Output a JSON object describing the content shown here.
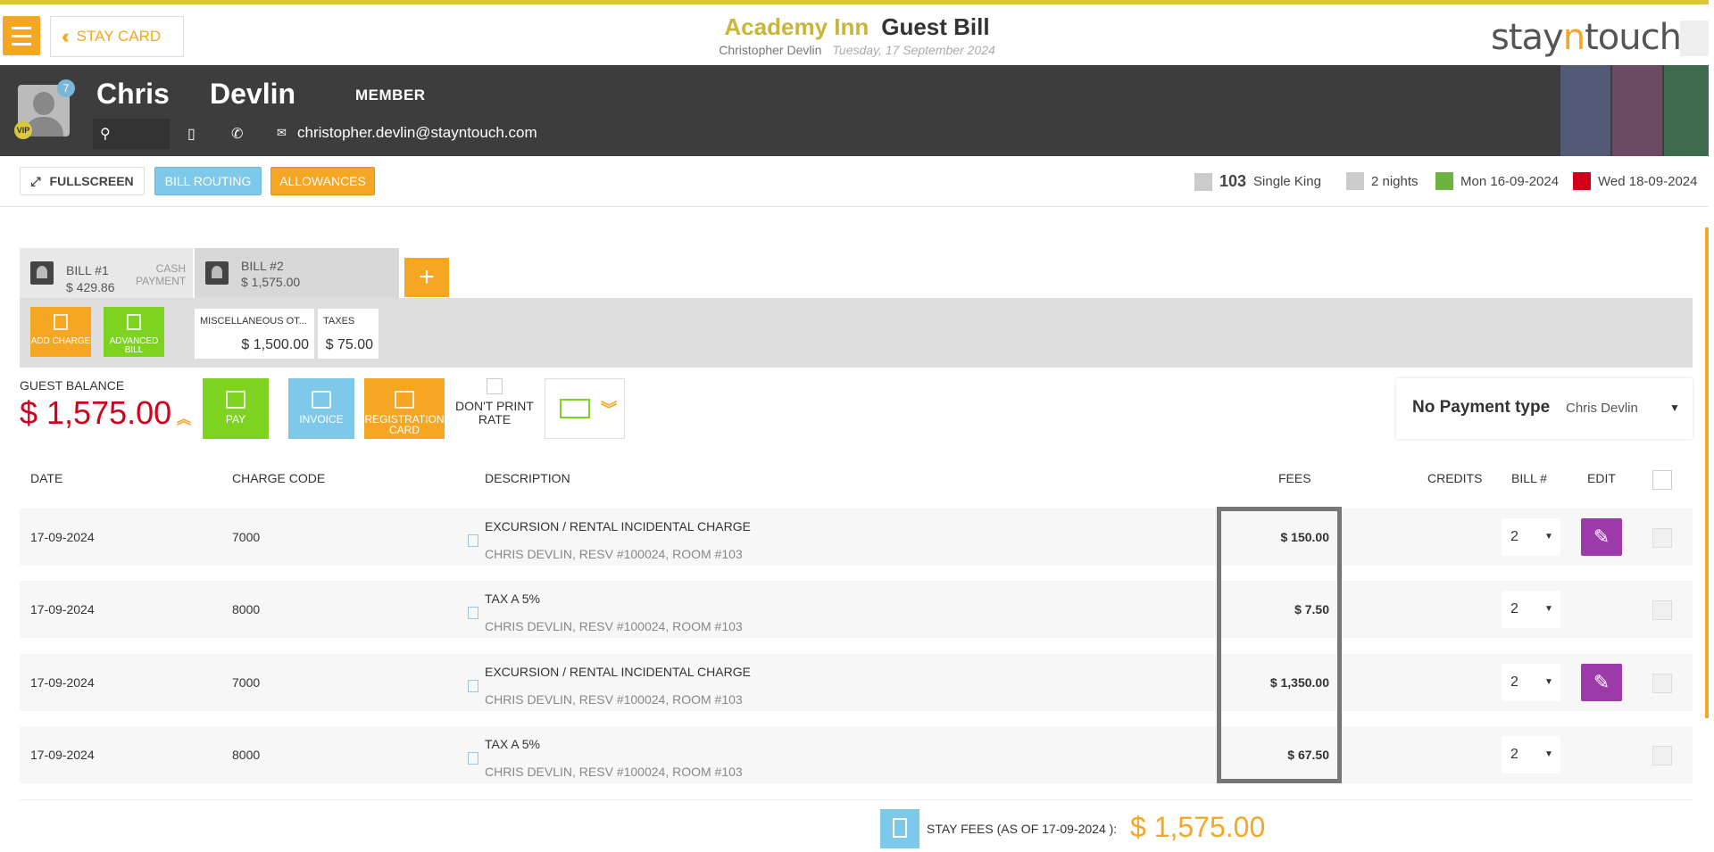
{
  "header": {
    "back_label": "STAY CARD",
    "hotel_name": "Academy Inn",
    "page_title": "Guest Bill",
    "guest_full_name": "Christopher Devlin",
    "date_text": "Tuesday, 17 September 2024",
    "logo_pre": "stay",
    "logo_n": "n",
    "logo_post": "touch"
  },
  "guest": {
    "first_name": "Chris",
    "last_name": "Devlin",
    "member_label": "MEMBER",
    "avatar_count": "7",
    "vip_label": "VIP",
    "email": "christopher.devlin@stayntouch.com"
  },
  "toolbar": {
    "fullscreen_label": "FULLSCREEN",
    "bill_routing_label": "BILL ROUTING",
    "allowances_label": "ALLOWANCES",
    "room_number": "103",
    "room_type": "Single King",
    "nights": "2 nights",
    "arrival": "Mon 16-09-2024",
    "departure": "Wed 18-09-2024"
  },
  "bills": {
    "tab1": {
      "label": "BILL #1",
      "amount": "$ 429.86",
      "caption": "CASH PAYMENT"
    },
    "tab2": {
      "label": "BILL #2",
      "amount": "$ 1,575.00"
    },
    "add_tab": "+",
    "add_charge_label": "ADD CHARGE",
    "advanced_bill_label": "ADVANCED BILL",
    "summary": [
      {
        "label": "MISCELLANEOUS OT...",
        "value": "$ 1,500.00"
      },
      {
        "label": "TAXES",
        "value": "$ 75.00"
      }
    ]
  },
  "balance": {
    "label": "GUEST BALANCE",
    "amount": "$ 1,575.00",
    "pay_label": "PAY",
    "invoice_label": "INVOICE",
    "registration_label": "REGISTRATION CARD",
    "dont_print_label": "DON'T PRINT RATE",
    "payment_type": "No Payment type",
    "payer_name": "Chris Devlin"
  },
  "table": {
    "headers": {
      "date": "DATE",
      "charge_code": "CHARGE CODE",
      "description": "DESCRIPTION",
      "fees": "FEES",
      "credits": "CREDITS",
      "bill_no": "BILL #",
      "edit": "EDIT"
    },
    "rows": [
      {
        "date": "17-09-2024",
        "code": "7000",
        "desc": "EXCURSION / RENTAL INCIDENTAL CHARGE",
        "sub": "CHRIS DEVLIN, RESV #100024, ROOM #103",
        "fee": "$ 150.00",
        "bill": "2",
        "editable": true
      },
      {
        "date": "17-09-2024",
        "code": "8000",
        "desc": "TAX A 5%",
        "sub": "CHRIS DEVLIN, RESV #100024, ROOM #103",
        "fee": "$ 7.50",
        "bill": "2",
        "editable": false
      },
      {
        "date": "17-09-2024",
        "code": "7000",
        "desc": "EXCURSION / RENTAL INCIDENTAL CHARGE",
        "sub": "CHRIS DEVLIN, RESV #100024, ROOM #103",
        "fee": "$ 1,350.00",
        "bill": "2",
        "editable": true
      },
      {
        "date": "17-09-2024",
        "code": "8000",
        "desc": "TAX A 5%",
        "sub": "CHRIS DEVLIN, RESV #100024, ROOM #103",
        "fee": "$ 67.50",
        "bill": "2",
        "editable": false
      }
    ]
  },
  "footer": {
    "stay_fees_label": "STAY FEES (AS OF  17-09-2024 ):",
    "stay_fees_amount": "$ 1,575.00"
  },
  "colors": {
    "accent_orange": "#f5a623",
    "brand_gold": "#c8b53a",
    "balance_red": "#d0021b",
    "edit_purple": "#9b3aa8",
    "header_dark": "#3d3d3d"
  }
}
